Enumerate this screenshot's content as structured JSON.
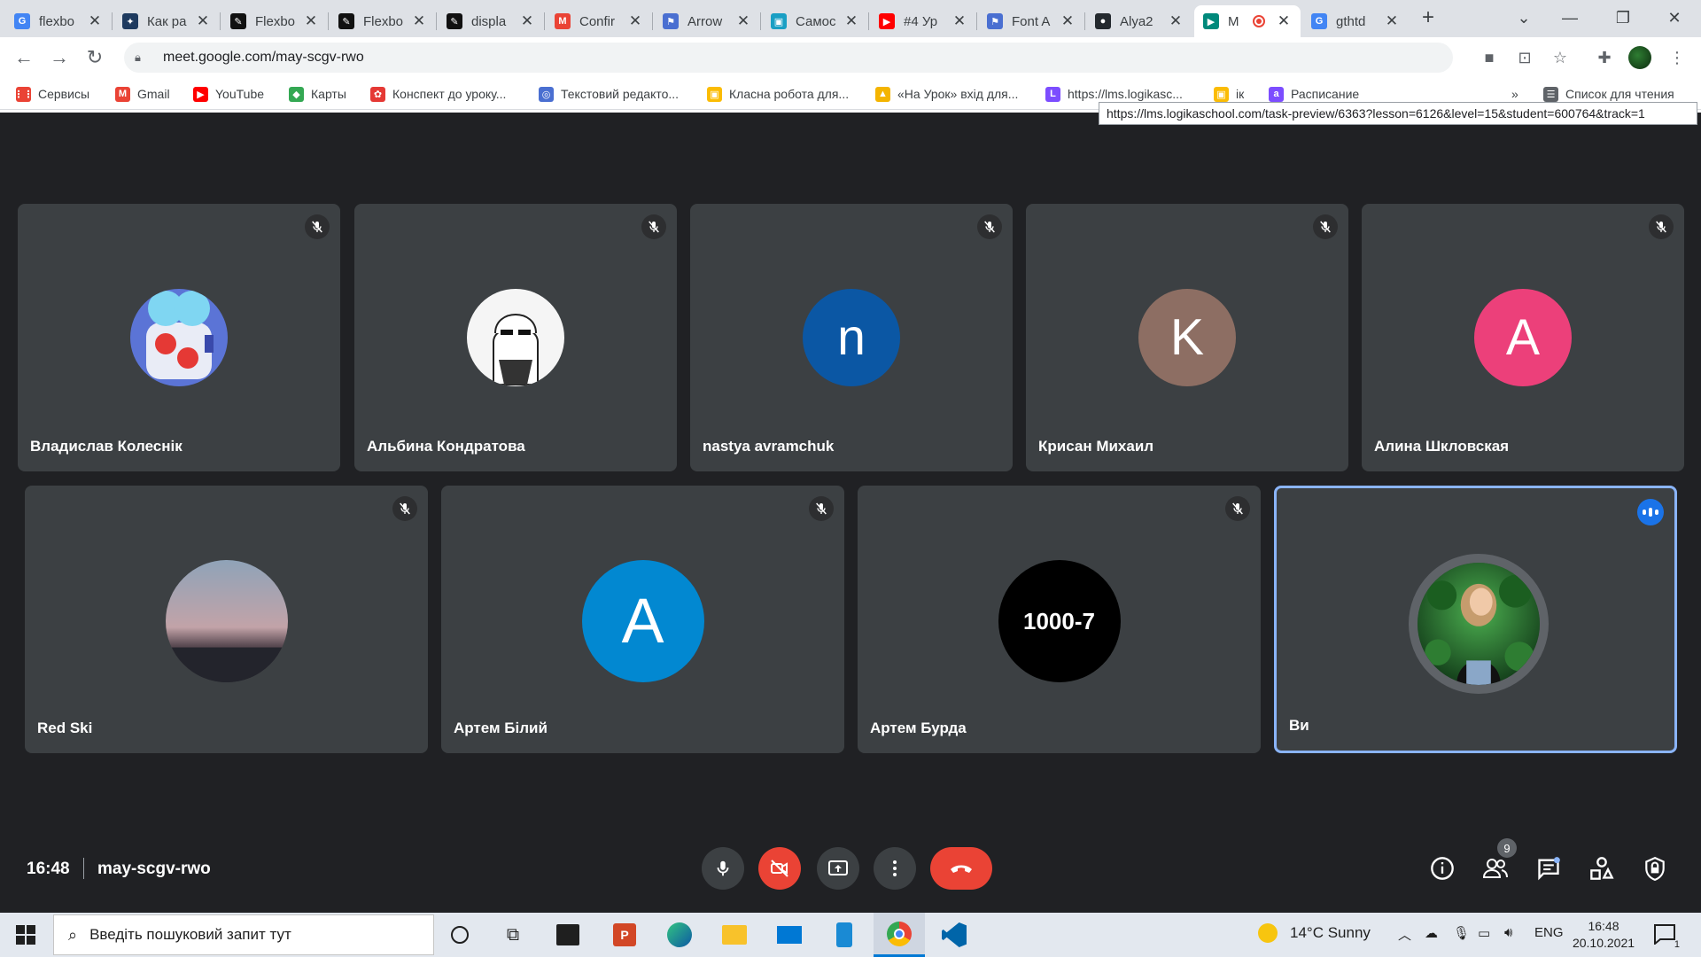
{
  "browser": {
    "tabs": [
      {
        "label": "flexbo",
        "fav": "G",
        "color": "#4285f4"
      },
      {
        "label": "Как ра",
        "fav": "✦",
        "color": "#1e3a5f"
      },
      {
        "label": "Flexbo",
        "fav": "✎",
        "color": "#111111"
      },
      {
        "label": "Flexbo",
        "fav": "✎",
        "color": "#111111"
      },
      {
        "label": "displa",
        "fav": "✎",
        "color": "#111111"
      },
      {
        "label": "Confir",
        "fav": "M",
        "color": "#ea4335"
      },
      {
        "label": "Arrow",
        "fav": "⚑",
        "color": "#4a6fd1"
      },
      {
        "label": "Самос",
        "fav": "▣",
        "color": "#1a9fc4"
      },
      {
        "label": "#4 Ур",
        "fav": "▶",
        "color": "#ff0000"
      },
      {
        "label": "Font A",
        "fav": "⚑",
        "color": "#4a6fd1"
      },
      {
        "label": "Alya2",
        "fav": "●",
        "color": "#24292e"
      },
      {
        "label": "M",
        "fav": "▶",
        "color": "#00897b",
        "active": true
      },
      {
        "label": "gthtd",
        "fav": "G",
        "color": "#4285f4"
      }
    ],
    "url": "meet.google.com/may-scgv-rwo",
    "bookmarks": [
      {
        "label": "Сервисы",
        "fav": "⋮⋮",
        "color": "#ea4335"
      },
      {
        "label": "Gmail",
        "fav": "M",
        "color": "#ea4335"
      },
      {
        "label": "YouTube",
        "fav": "▶",
        "color": "#ff0000"
      },
      {
        "label": "Карты",
        "fav": "◆",
        "color": "#34a853"
      },
      {
        "label": "Конспект до уроку...",
        "fav": "✿",
        "color": "#e53935"
      },
      {
        "label": "Текстовий редакто...",
        "fav": "◎",
        "color": "#4a6fd1"
      },
      {
        "label": "Класна робота для...",
        "fav": "▣",
        "color": "#fbbc04"
      },
      {
        "label": "«На Урок» вхід для...",
        "fav": "▲",
        "color": "#f4b400"
      },
      {
        "label": "https://lms.logikasc...",
        "fav": "L",
        "color": "#7c4dff"
      },
      {
        "label": "ік",
        "fav": "▣",
        "color": "#fbbc04"
      },
      {
        "label": "Расписание",
        "fav": "a",
        "color": "#7c4dff"
      },
      {
        "label": "Список для чтения",
        "fav": "☰",
        "color": "#5f6368"
      }
    ],
    "tooltip": "https://lms.logikaschool.com/task-preview/6363?lesson=6126&level=15&student=600764&track=1"
  },
  "meet": {
    "time": "16:48",
    "code": "may-scgv-rwo",
    "participant_count": "9",
    "participants": [
      {
        "name": "Владислав Колеснік",
        "type": "image",
        "img": "robot"
      },
      {
        "name": "Альбина Кондратова",
        "type": "image",
        "img": "sketch"
      },
      {
        "name": "nastya avramchuk",
        "type": "letter",
        "letter": "n",
        "color": "#0b57a4"
      },
      {
        "name": "Крисан Михаил",
        "type": "letter",
        "letter": "K",
        "color": "#8d6e63"
      },
      {
        "name": "Алина Шкловская",
        "type": "letter",
        "letter": "A",
        "color": "#ec407a"
      },
      {
        "name": "Red Ski",
        "type": "image",
        "img": "sky"
      },
      {
        "name": "Артем Білий",
        "type": "letter",
        "letter": "A",
        "color": "#0288d1"
      },
      {
        "name": "Артем Бурда",
        "type": "text",
        "letter": "1000-7",
        "color": "#000000"
      },
      {
        "name": "Ви",
        "type": "image",
        "img": "girl",
        "self": true
      }
    ]
  },
  "taskbar": {
    "search_placeholder": "Введіть пошуковий запит тут",
    "weather": "14°C  Sunny",
    "lang": "ENG",
    "time": "16:48",
    "date": "20.10.2021",
    "notif_count": "1"
  }
}
